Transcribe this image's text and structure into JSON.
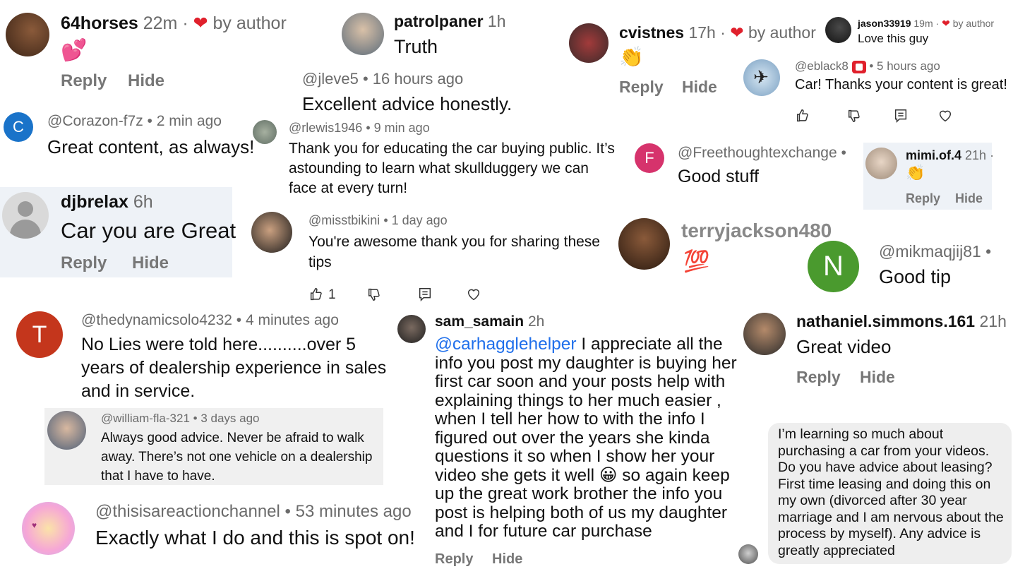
{
  "c1": {
    "username": "64horses",
    "time": "22m",
    "by_author": "by author",
    "emoji": "💕",
    "reply": "Reply",
    "hide": "Hide"
  },
  "c2": {
    "username": "patrolpaner",
    "time": "1h",
    "text": "Truth"
  },
  "c3": {
    "username": "cvistnes",
    "time": "17h",
    "by_author": "by author",
    "emoji": "👏",
    "reply": "Reply",
    "hide": "Hide"
  },
  "c4": {
    "username": "jason33919",
    "time": "19m",
    "by_author": "by author",
    "text": "Love this guy"
  },
  "c5": {
    "handle": "@jleve5",
    "time": "16 hours ago",
    "text": "Excellent advice honestly."
  },
  "c6": {
    "handle": "@eblack8",
    "time": "5 hours ago",
    "text": "Car! Thanks your content is great!"
  },
  "c7": {
    "avatar_letter": "C",
    "handle": "@Corazon-f7z",
    "time": "2 min ago",
    "text": "Great content, as always!"
  },
  "c8": {
    "handle": "@rlewis1946",
    "time": "9 min ago",
    "text": "Thank you for educating the car buying public. It’s astounding to learn what skullduggery we can face at every turn!"
  },
  "c9": {
    "avatar_letter": "F",
    "handle": "@Freethoughtexchange",
    "time": "",
    "text": "Good stuff"
  },
  "c10": {
    "username": "mimi.of.4",
    "time": "21h",
    "emoji": "👏",
    "reply": "Reply",
    "hide": "Hide"
  },
  "c11": {
    "username": "djbrelax",
    "time": "6h",
    "text": "Car you are Great",
    "reply": "Reply",
    "hide": "Hide"
  },
  "c12": {
    "handle": "@misstbikini",
    "time": "1 day ago",
    "text": "You're awesome thank you for sharing these tips",
    "like_count": "1"
  },
  "c13": {
    "username": "terryjackson480",
    "emoji": "💯"
  },
  "c14": {
    "avatar_letter": "N",
    "handle": "@mikmaqjij81",
    "time": "",
    "text": "Good tip"
  },
  "c15": {
    "avatar_letter": "T",
    "handle": "@thedynamicsolo4232",
    "time": "4 minutes ago",
    "text": "No Lies were told here..........over 5 years of dealership experience in sales and in service."
  },
  "c16": {
    "username": "sam_samain",
    "time": "2h",
    "mention": "@carhagglehelper",
    "text": " I appreciate all the info you post my daughter is buying her first car soon and your posts help with explaining things to her much easier , when I tell her how to with the info I figured out over the years she kinda questions it so when I show her your video she gets it well 😀  so again keep up the great work brother the info you post is helping both of us my daughter and I for future car purchase",
    "reply": "Reply",
    "hide": "Hide"
  },
  "c17": {
    "username": "nathaniel.simmons.161",
    "time": "21h",
    "text": "Great video",
    "reply": "Reply",
    "hide": "Hide"
  },
  "c18": {
    "handle": "@william-fla-321",
    "time": "3 days ago",
    "text": "Always good advice. Never be afraid to walk away. There’s not one vehicle on a dealership that I have to have."
  },
  "c19": {
    "handle": "@thisisareactionchannel",
    "time": "53 minutes ago",
    "text": "Exactly what I do and this is spot on!"
  },
  "c20": {
    "text": "I’m learning so much about purchasing a car from your videos. Do you have advice about leasing? First time leasing and doing this on my own (divorced after 30 year marriage and I am nervous about the process by myself). Any advice is greatly appreciated"
  },
  "colors": {
    "heart": "#e0202c",
    "link": "#1f6feb",
    "muted": "#6b6b6b",
    "panel": "#eef2f7",
    "avatar_c": "#1a73c9",
    "avatar_f": "#d6336c",
    "avatar_n": "#4a9a2e",
    "avatar_t": "#c4361c"
  }
}
